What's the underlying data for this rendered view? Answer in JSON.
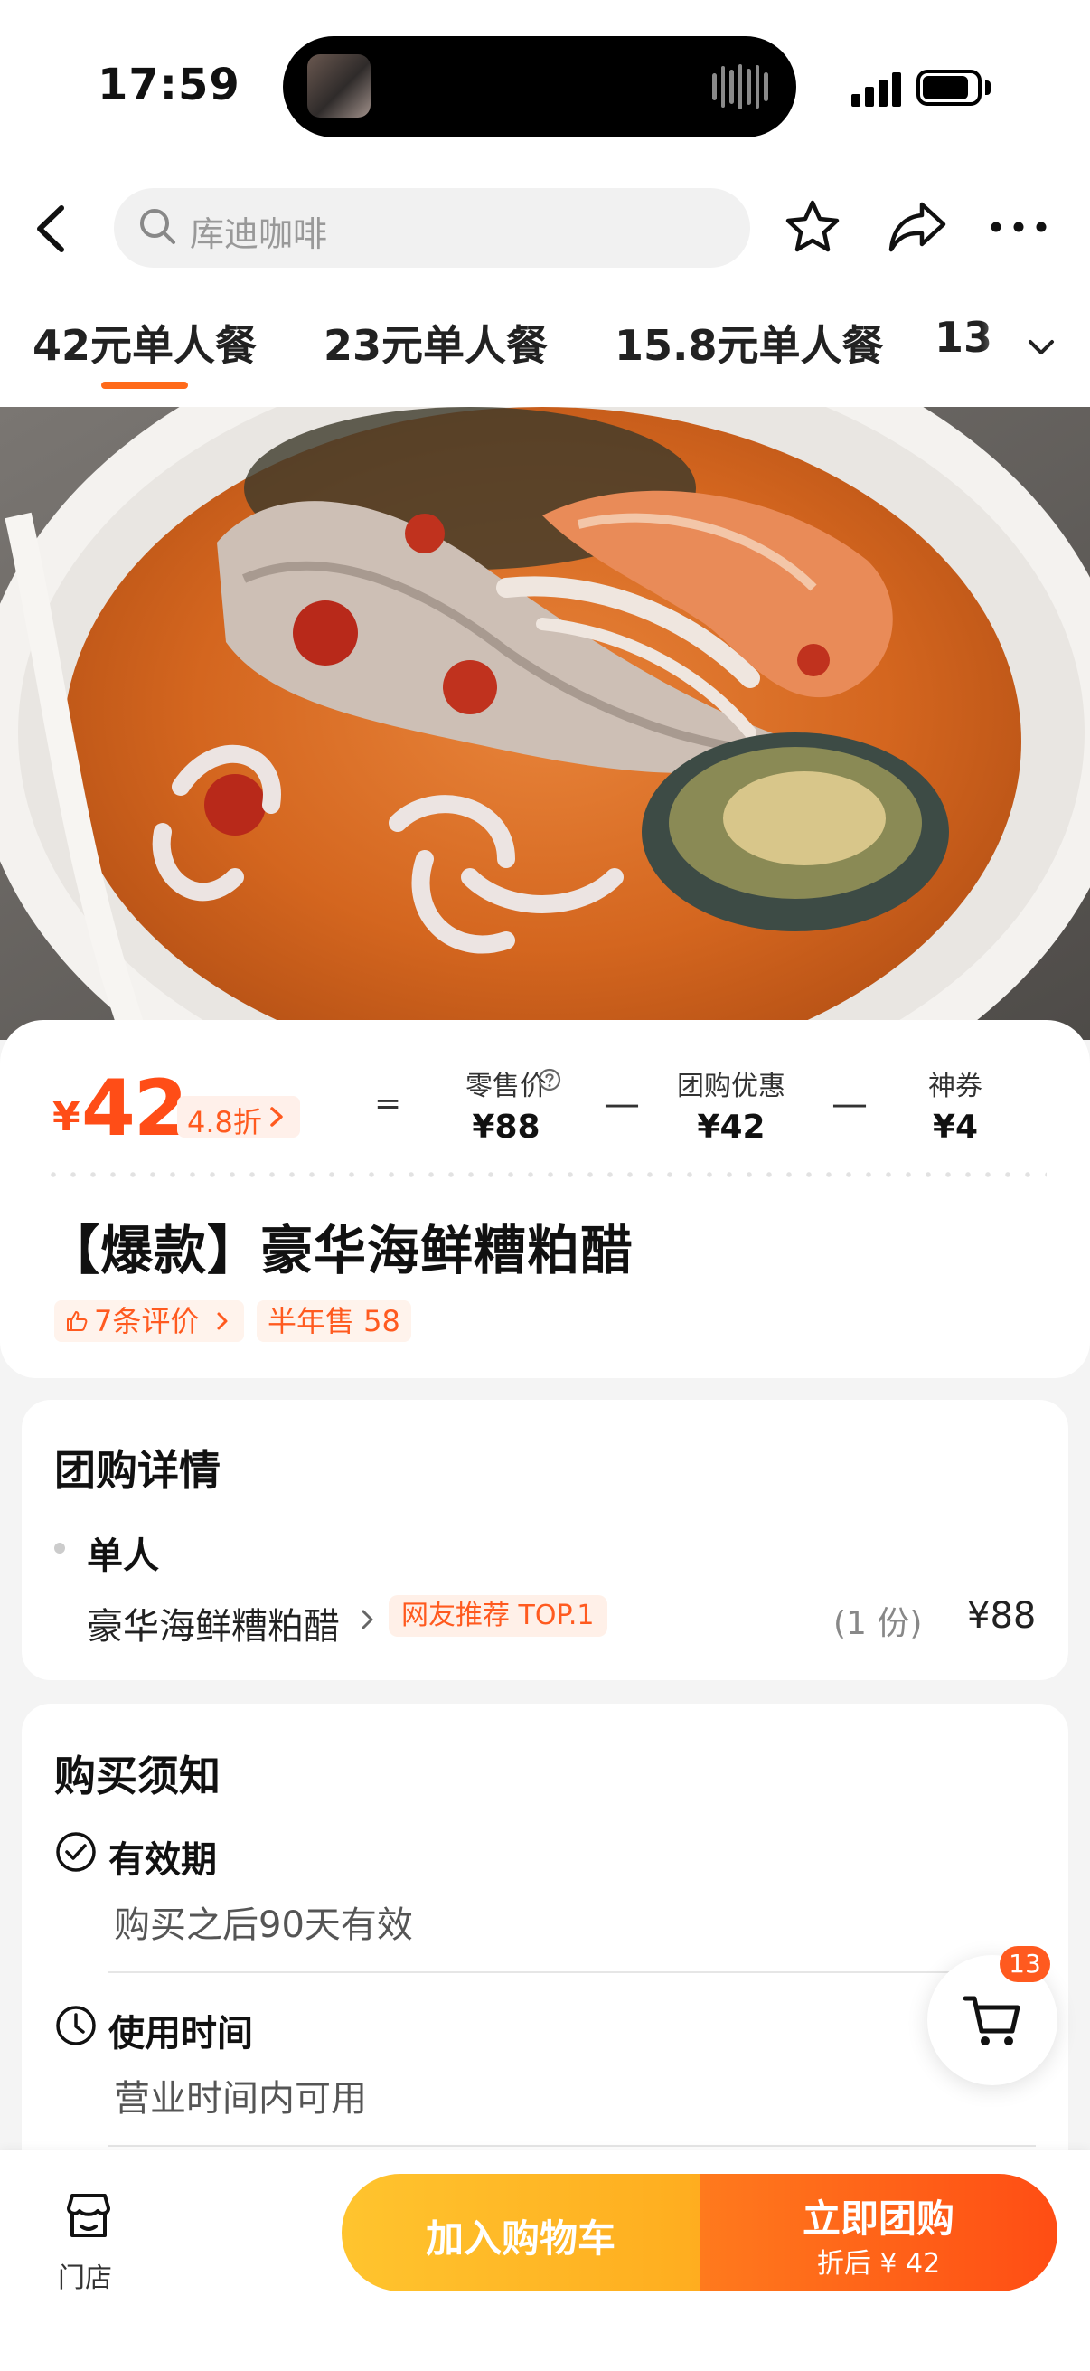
{
  "status": {
    "time": "17:59"
  },
  "nav": {
    "search_placeholder": "库迪咖啡"
  },
  "tabs": [
    {
      "label": "42元单人餐",
      "active": true
    },
    {
      "label": "23元单人餐",
      "active": false
    },
    {
      "label": "15.8元单人餐",
      "active": false
    },
    {
      "label": "13",
      "active": false
    }
  ],
  "price": {
    "currency": "¥",
    "amount": "42",
    "discount": "4.8折",
    "equals": "=",
    "minus": "—",
    "retail_label": "零售价",
    "retail_value": "¥88",
    "group_label": "团购优惠",
    "group_value": "¥42",
    "coupon_label": "神券",
    "coupon_value": "¥4"
  },
  "product": {
    "title": "【爆款】豪华海鲜糟粕醋",
    "reviews": "7条评价",
    "sales": "半年售 58"
  },
  "details": {
    "heading": "团购详情",
    "group": "单人",
    "item_name": "豪华海鲜糟粕醋",
    "item_tag": "网友推荐 TOP.1",
    "item_qty": "(1 份)",
    "item_price": "¥88"
  },
  "notice": {
    "heading": "购买须知",
    "validity_title": "有效期",
    "validity_text": "购买之后90天有效",
    "time_title": "使用时间",
    "time_text": "营业时间内可用"
  },
  "cart": {
    "count": "13"
  },
  "bottom": {
    "store_label": "门店",
    "add_cart": "加入购物车",
    "buy_now": "立即团购",
    "buy_sub": "折后 ¥ 42"
  },
  "colors": {
    "accent": "#ff4d17",
    "cart_btn": "#ffb522",
    "buy_btn": "#ff5a16"
  }
}
